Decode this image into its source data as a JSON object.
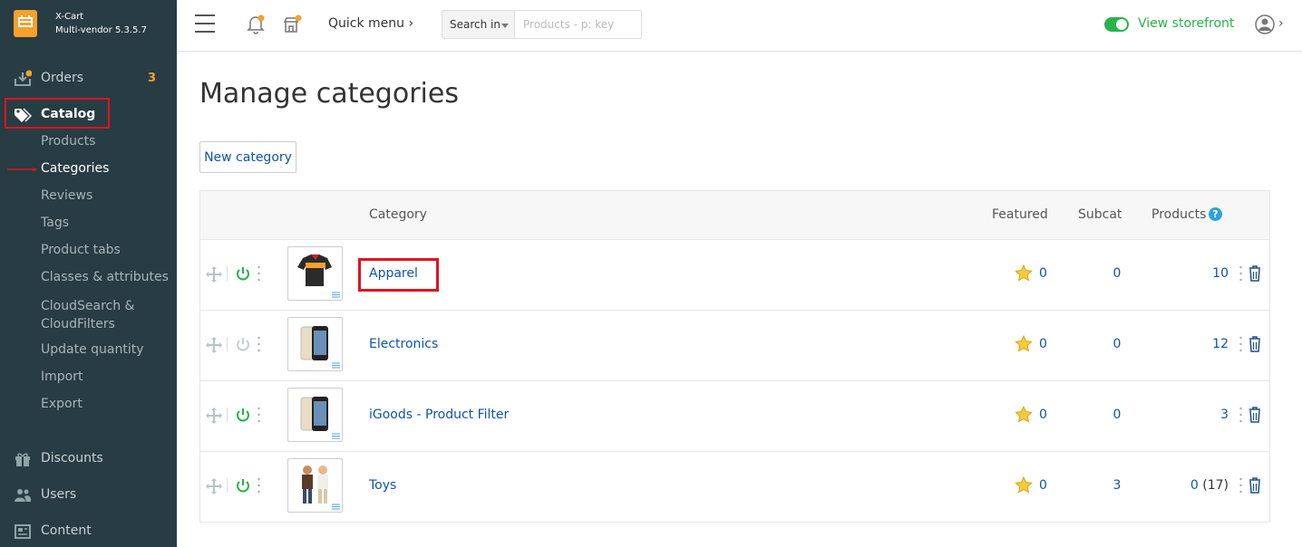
{
  "brand": {
    "title": "X-Cart",
    "version": "Multi-vendor 5.3.5.7"
  },
  "sidebar": {
    "orders": {
      "label": "Orders",
      "badge": "3",
      "icon": "download-tray-icon"
    },
    "catalog": {
      "label": "Catalog",
      "icon": "tags-icon"
    },
    "catalog_items": [
      {
        "label": "Products"
      },
      {
        "label": "Categories",
        "current": true
      },
      {
        "label": "Reviews"
      },
      {
        "label": "Tags"
      },
      {
        "label": "Product tabs"
      },
      {
        "label": "Classes & attributes"
      },
      {
        "label": "CloudSearch & CloudFilters"
      },
      {
        "label": "Update quantity"
      },
      {
        "label": "Import"
      },
      {
        "label": "Export"
      }
    ],
    "discounts": {
      "label": "Discounts",
      "icon": "gift-icon"
    },
    "users": {
      "label": "Users",
      "icon": "users-icon"
    },
    "content": {
      "label": "Content",
      "icon": "newspaper-icon"
    }
  },
  "topbar": {
    "quick_menu": "Quick menu",
    "search_in": "Search in",
    "search_placeholder": "Products - p: key",
    "storefront": "View storefront"
  },
  "main": {
    "title": "Manage categories",
    "new_category_button": "New category"
  },
  "table": {
    "headers": {
      "category": "Category",
      "featured": "Featured",
      "subcat": "Subcat",
      "products": "Products"
    },
    "rows": [
      {
        "name": "Apparel",
        "enabled": true,
        "featured": "0",
        "subcat": "0",
        "products": "10",
        "products_extra": "",
        "thumb": "jersey"
      },
      {
        "name": "Electronics",
        "enabled": false,
        "featured": "0",
        "subcat": "0",
        "products": "12",
        "products_extra": "",
        "thumb": "phone"
      },
      {
        "name": "iGoods - Product Filter",
        "enabled": true,
        "featured": "0",
        "subcat": "0",
        "products": "3",
        "products_extra": "",
        "thumb": "phone"
      },
      {
        "name": "Toys",
        "enabled": true,
        "featured": "0",
        "subcat": "3",
        "products": "0",
        "products_extra": " (17)",
        "thumb": "figures"
      }
    ]
  },
  "colors": {
    "sidebar_bg": "#283c43",
    "accent_orange": "#f6a02d",
    "link_blue": "#0e55a7",
    "green": "#29b34a",
    "highlight_red": "#e0141e"
  }
}
